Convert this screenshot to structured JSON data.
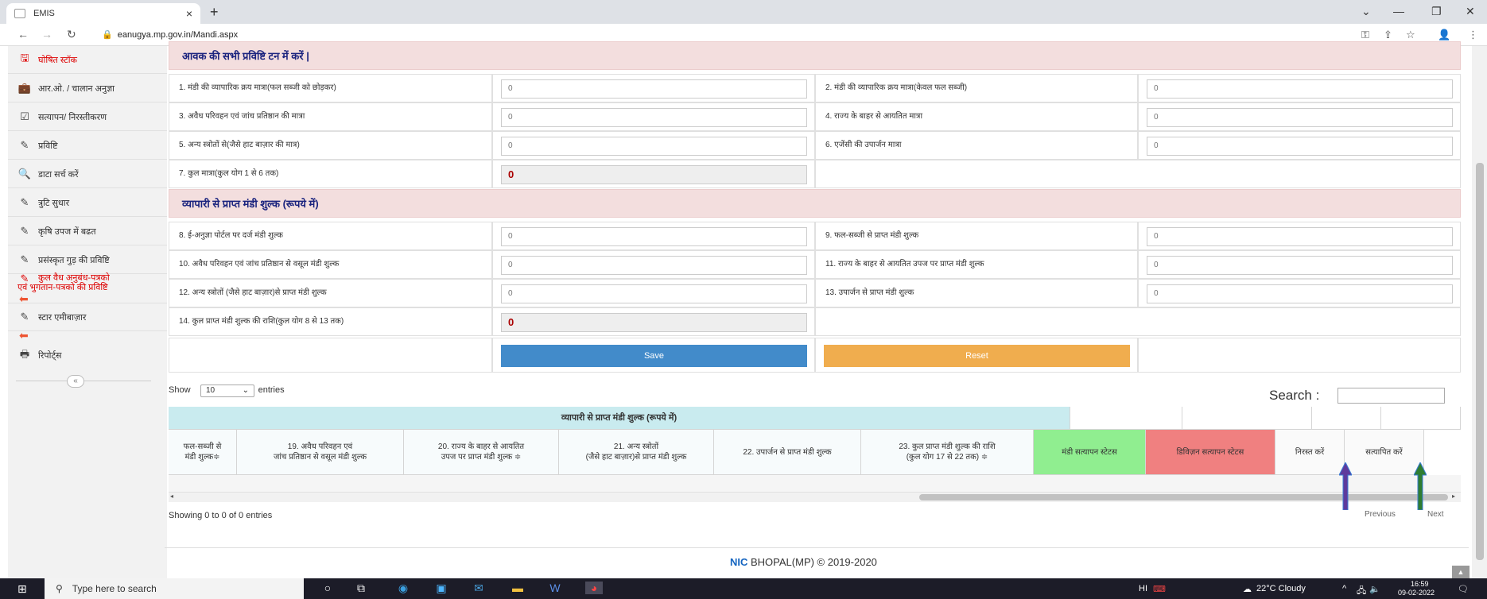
{
  "browser": {
    "tab_title": "EMIS",
    "tab_close": "×",
    "new_tab": "+",
    "url": "eanugya.mp.gov.in/Mandi.aspx",
    "controls": {
      "minimize": "—",
      "restore": "❐",
      "close": "✕",
      "chevron": "⌄"
    }
  },
  "sidebar": {
    "items": [
      {
        "label": "घोषित स्टॉक",
        "icon": "save-icon",
        "glyph": "🖫",
        "red": true
      },
      {
        "label": "आर.ओ. / चालान अनुज्ञा",
        "icon": "briefcase-icon",
        "glyph": "💼",
        "red": false
      },
      {
        "label": "सत्यापन/ निरस्तीकरण",
        "icon": "checkbox-icon",
        "glyph": "☑",
        "red": false
      },
      {
        "label": "प्रविष्टि",
        "icon": "edit-icon",
        "glyph": "✎",
        "red": false
      },
      {
        "label": "डाटा सर्च करें",
        "icon": "search-icon",
        "glyph": "🔍",
        "red": false
      },
      {
        "label": "त्रुटि सुधार",
        "icon": "edit-icon",
        "glyph": "✎",
        "red": false
      },
      {
        "label": "कृषि उपज में बढत",
        "icon": "edit-icon",
        "glyph": "✎",
        "red": false
      },
      {
        "label": "प्रसंस्कृत गुड़ की प्रविष्टि",
        "icon": "edit-icon",
        "glyph": "✎",
        "red": false
      }
    ],
    "red_item_line1": "कुल वैध अनुबंध-पत्रको",
    "red_item_line2": "एवं भुगतान-पत्रको की प्रविष्टि",
    "star_item": "स्टार एमीबाज़ार",
    "reports_item": "रिपोर्ट्स",
    "collapse_glyph": "«"
  },
  "form": {
    "section1_title": "आवक की सभी प्रविष्टि टन में करें |",
    "section2_title": "व्यापारी से प्राप्त मंडी शुल्क (रूपये में)",
    "fields1": [
      {
        "left_label": "1. मंडी की व्यापारिक क्रय मात्रा(फल सब्जी को छोड़कर)",
        "left_value": "0",
        "right_label": "2. मंडी की व्यापारिक क्रय मात्रा(केवल फल सब्जी)",
        "right_value": "0"
      },
      {
        "left_label": "3. अवैध परिवहन एवं जांच प्रतिष्ठान की मात्रा",
        "left_value": "0",
        "right_label": "4. राज्य के बाहर से आयतित मात्रा",
        "right_value": "0"
      },
      {
        "left_label": "5. अन्य स्त्रोतों से(जैसे हाट बाज़ार की मात्र)",
        "left_value": "0",
        "right_label": "6. एजेंसी की उपार्जन मात्रा",
        "right_value": "0"
      }
    ],
    "total1_label": "7. कुल मात्रा(कुल योग 1 से 6 तक)",
    "total1_value": "0",
    "fields2": [
      {
        "left_label": "8. ई-अनुज्ञा पोर्टल पर दर्ज मंडी शुल्क",
        "left_value": "0",
        "right_label": "9. फल-सब्जी से प्राप्त मंडी शुल्क",
        "right_value": "0"
      },
      {
        "left_label": "10. अवैध परिवहन एवं जांच प्रतिष्ठान से वसूल मंडी शुल्क",
        "left_value": "0",
        "right_label": "11. राज्य के बाहर से आयतित उपज पर प्राप्त मंडी शुल्क",
        "right_value": "0"
      },
      {
        "left_label": "12. अन्य स्त्रोतों (जैसे हाट बाज़ार)से प्राप्त मंडी शुल्क",
        "left_value": "0",
        "right_label": "13. उपार्जन से प्राप्त मंडी शुल्क",
        "right_value": "0"
      }
    ],
    "total2_label": "14. कुल प्राप्त मंडी शुल्क की राशि(कुल योग 8 से 13 तक)",
    "total2_value": "0",
    "save_label": "Save",
    "reset_label": "Reset"
  },
  "table": {
    "show_label": "Show",
    "length_value": "10",
    "entries_label": "entries",
    "search_label": "Search :",
    "group_header": "व्यापारी से प्राप्त मंडी शुल्क (रूपये में)",
    "columns": [
      {
        "line1": "फल-सब्जी से",
        "line2": "मंडी शुल्क≑"
      },
      {
        "line1": "19. अवैध परिवहन एवं",
        "line2": "जांच प्रतिष्ठान से वसूल मंडी शुल्क"
      },
      {
        "line1": "20. राज्य के बाहर से आयतित",
        "line2": "उपज पर प्राप्त मंडी शुल्क  ≑"
      },
      {
        "line1": "21. अन्य स्त्रोतों",
        "line2": "(जैसे हाट बाज़ार)से प्राप्त मंडी शुल्क"
      },
      {
        "line1": "22. उपार्जन से प्राप्त मंडी शुल्क",
        "line2": ""
      },
      {
        "line1": "23. कुल प्राप्त मंडी शुल्क की राशि",
        "line2": "(कुल योग 17 से 22 तक)   ≑"
      },
      {
        "line1": "मंडी सत्यापन स्टेटस",
        "line2": ""
      },
      {
        "line1": "डिविज़न सत्यापन स्टेटस",
        "line2": ""
      },
      {
        "line1": "निरस्त करें",
        "line2": ""
      },
      {
        "line1": "सत्यापित करें",
        "line2": ""
      }
    ],
    "sort_glyph": "≑",
    "info": "Showing 0 to 0 of 0 entries",
    "prev": "Previous",
    "next": "Next",
    "colors": {
      "green": "#90ee90",
      "red": "#f08080",
      "header_blue": "#c9ebef"
    }
  },
  "footer": {
    "nic": "NIC",
    "text": " BHOPAL(MP) © 2019-2020"
  },
  "taskbar": {
    "search_placeholder": "Type here to search",
    "weather": "22°C  Cloudy",
    "time": "16:59",
    "date": "09-02-2022",
    "lang": "HI"
  }
}
